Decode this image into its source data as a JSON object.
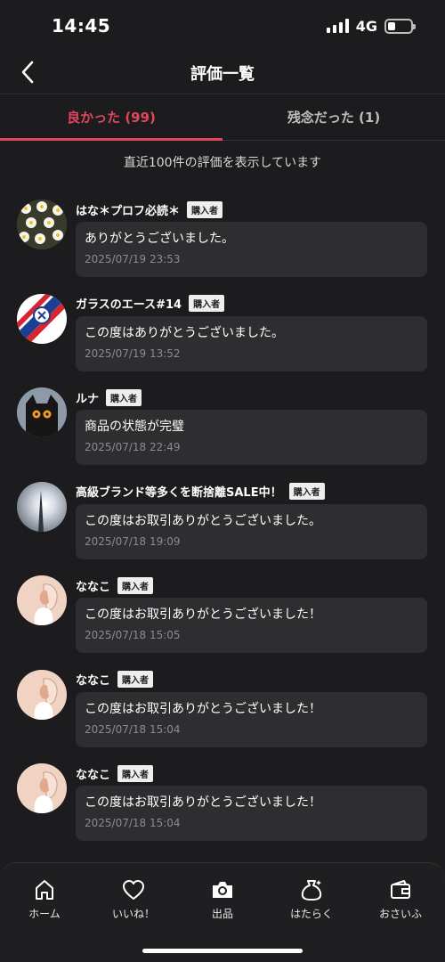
{
  "status_bar": {
    "time": "14:45",
    "network": "4G",
    "signal_icon": "signal-icon",
    "battery_icon": "battery-icon"
  },
  "header": {
    "title": "評価一覧",
    "back_icon": "chevron-left-icon"
  },
  "tabs": [
    {
      "label": "良かった (99)",
      "active": true
    },
    {
      "label": "残念だった (1)",
      "active": false
    }
  ],
  "notice": "直近100件の評価を表示しています",
  "reviews": [
    {
      "name": "はな＊プロフ必読＊",
      "badge": "購入者",
      "text": "ありがとうございました。",
      "date": "2025/07/19 23:53"
    },
    {
      "name": "ガラスのエース#14",
      "badge": "購入者",
      "text": "この度はありがとうございました。",
      "date": "2025/07/19 13:52"
    },
    {
      "name": "ルナ",
      "badge": "購入者",
      "text": "商品の状態が完璧",
      "date": "2025/07/18 22:49"
    },
    {
      "name": "高級ブランド等多くを断捨離SALE中！",
      "badge": "購入者",
      "text": "この度はお取引ありがとうございました。",
      "date": "2025/07/18 19:09"
    },
    {
      "name": "ななこ",
      "badge": "購入者",
      "text": "この度はお取引ありがとうございました！",
      "date": "2025/07/18 15:05"
    },
    {
      "name": "ななこ",
      "badge": "購入者",
      "text": "この度はお取引ありがとうございました！",
      "date": "2025/07/18 15:04"
    },
    {
      "name": "ななこ",
      "badge": "購入者",
      "text": "この度はお取引ありがとうございました！",
      "date": "2025/07/18 15:04"
    }
  ],
  "bottom_nav": [
    {
      "label": "ホーム",
      "icon": "home-icon"
    },
    {
      "label": "いいね！",
      "icon": "heart-icon"
    },
    {
      "label": "出品",
      "icon": "camera-icon"
    },
    {
      "label": "はたらく",
      "icon": "money-bag-icon"
    },
    {
      "label": "おさいふ",
      "icon": "wallet-icon"
    }
  ],
  "colors": {
    "background": "#1c1c1e",
    "accent": "#e2465c",
    "bubble": "#2e2e30"
  },
  "battery_level": 0.35
}
